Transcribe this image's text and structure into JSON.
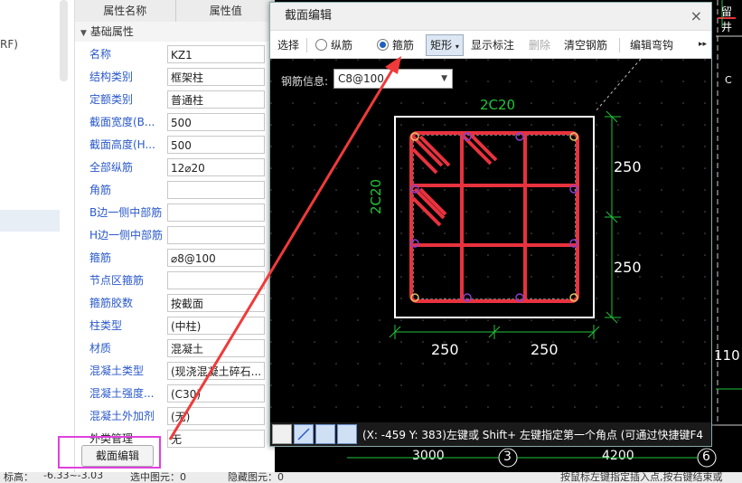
{
  "left_panel": {
    "rf_text": "RF)"
  },
  "props": {
    "header_name": "属性名称",
    "header_value": "属性值",
    "group": "基础属性",
    "rows": [
      {
        "name": "名称",
        "value": "KZ1",
        "style": "blue"
      },
      {
        "name": "结构类别",
        "value": "框架柱",
        "style": "blue"
      },
      {
        "name": "定额类别",
        "value": "普通柱",
        "style": "blue"
      },
      {
        "name": "截面宽度(B...",
        "value": "500",
        "style": "blue"
      },
      {
        "name": "截面高度(H...",
        "value": "500",
        "style": "blue"
      },
      {
        "name": "全部纵筋",
        "value": "12⌀20",
        "style": "blue"
      },
      {
        "name": "角筋",
        "value": "",
        "style": "blue"
      },
      {
        "name": "B边一侧中部筋",
        "value": "",
        "style": "blue"
      },
      {
        "name": "H边一侧中部筋",
        "value": "",
        "style": "blue"
      },
      {
        "name": "箍筋",
        "value": "⌀8@100",
        "style": "blue"
      },
      {
        "name": "节点区箍筋",
        "value": "",
        "style": "blue"
      },
      {
        "name": "箍筋胶数",
        "value": "按截面",
        "style": "blue"
      },
      {
        "name": "柱类型",
        "value": "(中柱)",
        "style": "blue"
      },
      {
        "name": "材质",
        "value": "混凝土",
        "style": "blue"
      },
      {
        "name": "混凝土类型",
        "value": "(现浇混凝土碎石...",
        "style": "blue"
      },
      {
        "name": "混凝土强度...",
        "value": "(C30)",
        "style": "blue"
      },
      {
        "name": "混凝土外加剂",
        "value": "(无)",
        "style": "blue"
      },
      {
        "name": "外类管理",
        "value": "无",
        "style": "black"
      }
    ],
    "section_edit_button": "截面编辑"
  },
  "dialog": {
    "title": "截面编辑",
    "close": "×",
    "toolbar": {
      "select": "选择",
      "longitudinal": "纵筋",
      "stirrup": "箍筋",
      "shape": "矩形",
      "show_label": "显示标注",
      "delete": "删除",
      "clear": "清空钢筋",
      "edit_hook": "编辑弯钩",
      "more": "▸▸"
    },
    "rebar_info_label": "钢筋信息:",
    "rebar_info_value": "C8@100",
    "labels": {
      "top": "2C20",
      "left": "2C20",
      "right_upper": "250",
      "right_lower": "250",
      "bottom_left": "250",
      "bottom_right": "250"
    },
    "coord_text": "(X: -459 Y: 383)左键或 Shift+ 左键指定第一个角点 (可通过快捷键F4"
  },
  "cad": {
    "axis_3000": "3000",
    "axis_4200": "4200",
    "axis_3": "3",
    "axis_6": "6",
    "side_text_1": "留井",
    "side_text_c": "C",
    "side_text_110": "110"
  },
  "status": {
    "elevation": "标高：",
    "elevation_value": "-6.33~-3.03",
    "selected": "选中图元：0",
    "hidden": "隐藏图元：0",
    "hint": "按鼠标左键指定插入点,按右键结束或"
  },
  "colors": {
    "rebar": "#e8323e",
    "dim": "#22c43a",
    "frame": "#ffffff",
    "highlight": "#e040e0",
    "arrow": "#f03a3a"
  }
}
